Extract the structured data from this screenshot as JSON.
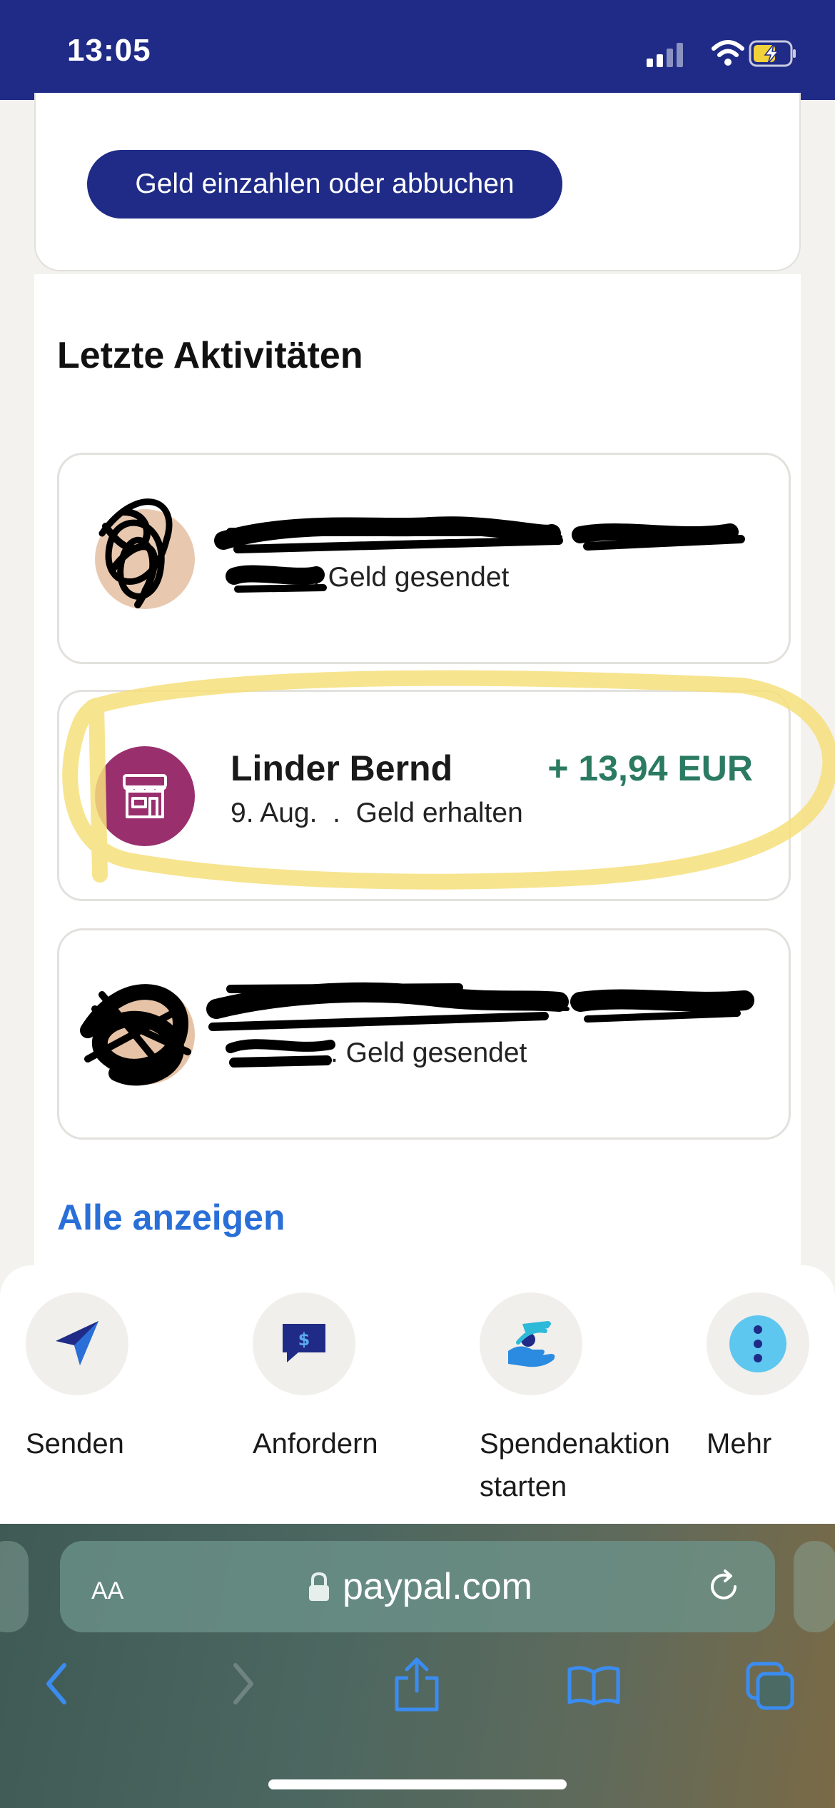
{
  "status_bar": {
    "time": "13:05"
  },
  "top_card": {
    "button_label": "Geld einzahlen oder abbuchen"
  },
  "activity": {
    "title": "Letzte Aktivitäten",
    "items": [
      {
        "name": "",
        "date": "",
        "type": "Geld gesendet",
        "amount": "",
        "redacted": true
      },
      {
        "name": "Linder Bernd",
        "date": "9. Aug.",
        "type": "Geld erhalten",
        "amount": "+ 13,94 EUR",
        "redacted": false
      },
      {
        "name": "",
        "date": "",
        "type": "Geld gesendet",
        "amount": "",
        "redacted": true
      }
    ],
    "see_all": "Alle anzeigen"
  },
  "actions": [
    {
      "label": "Senden",
      "icon": "send-icon"
    },
    {
      "label": "Anfordern",
      "icon": "request-icon"
    },
    {
      "label": "Spendenaktion starten",
      "icon": "fundraiser-icon"
    },
    {
      "label": "Mehr",
      "icon": "more-icon"
    }
  ],
  "browser": {
    "text_size_label": "AA",
    "url": "paypal.com"
  },
  "colors": {
    "brand_navy": "#1f2b86",
    "received_green": "#2b7a62",
    "link_blue": "#2a6fd8",
    "merchant_avatar": "#9a2f6e",
    "highlight_yellow": "#f6df7a"
  }
}
